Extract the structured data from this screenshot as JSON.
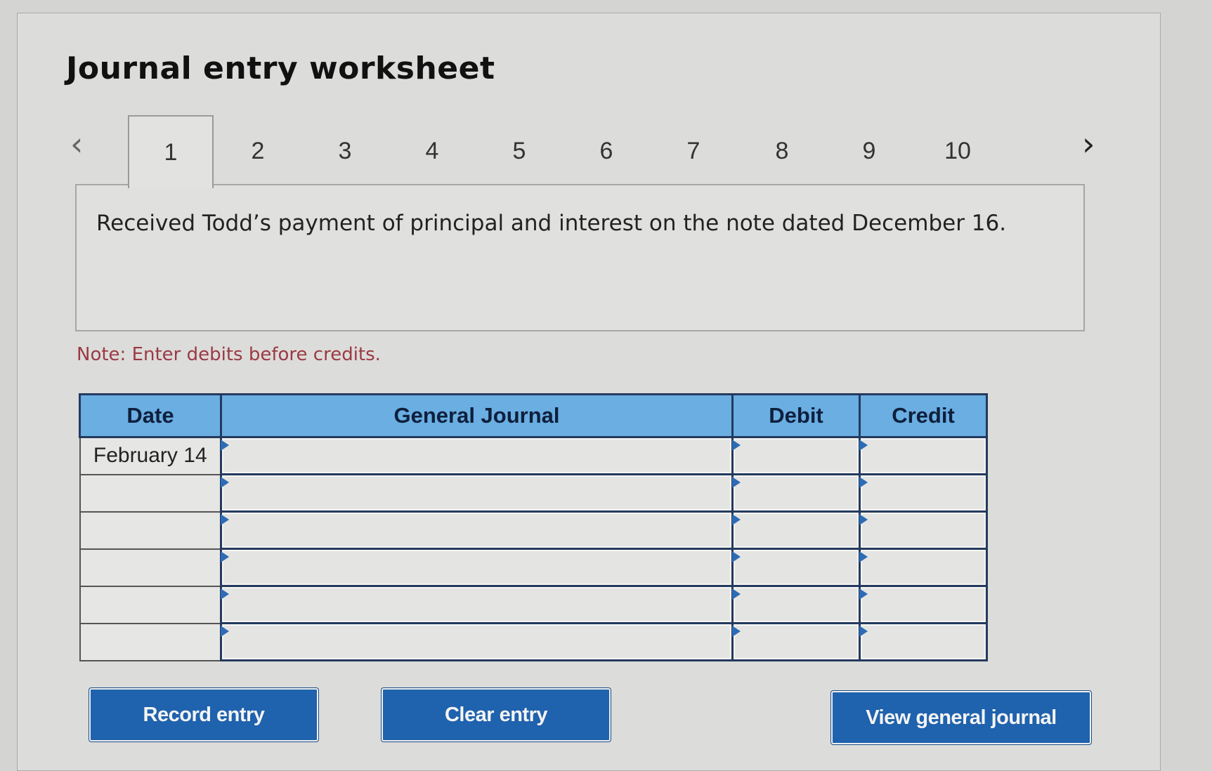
{
  "worksheet": {
    "title": "Journal entry worksheet",
    "nav": {
      "prev_icon": "chevron-left-icon",
      "next_icon": "chevron-right-icon",
      "prev_glyph": "‹",
      "next_glyph": "›"
    },
    "tabs": [
      {
        "label": "1",
        "active": true
      },
      {
        "label": "2",
        "active": false
      },
      {
        "label": "3",
        "active": false
      },
      {
        "label": "4",
        "active": false
      },
      {
        "label": "5",
        "active": false
      },
      {
        "label": "6",
        "active": false
      },
      {
        "label": "7",
        "active": false
      },
      {
        "label": "8",
        "active": false
      },
      {
        "label": "9",
        "active": false
      },
      {
        "label": "10",
        "active": false
      }
    ],
    "question": "Received Todd’s payment of principal and interest on the note dated December 16.",
    "note": "Note: Enter debits before credits."
  },
  "journal": {
    "headers": {
      "date": "Date",
      "general_journal": "General Journal",
      "debit": "Debit",
      "credit": "Credit"
    },
    "rows": [
      {
        "date": "February 14",
        "account": "",
        "debit": "",
        "credit": ""
      },
      {
        "date": "",
        "account": "",
        "debit": "",
        "credit": ""
      },
      {
        "date": "",
        "account": "",
        "debit": "",
        "credit": ""
      },
      {
        "date": "",
        "account": "",
        "debit": "",
        "credit": ""
      },
      {
        "date": "",
        "account": "",
        "debit": "",
        "credit": ""
      },
      {
        "date": "",
        "account": "",
        "debit": "",
        "credit": ""
      }
    ]
  },
  "buttons": {
    "record": "Record entry",
    "clear": "Clear entry",
    "view": "View general journal"
  },
  "colors": {
    "header_bg": "#6aaee2",
    "button_bg": "#1f62ad",
    "note_text": "#9a3a44"
  }
}
